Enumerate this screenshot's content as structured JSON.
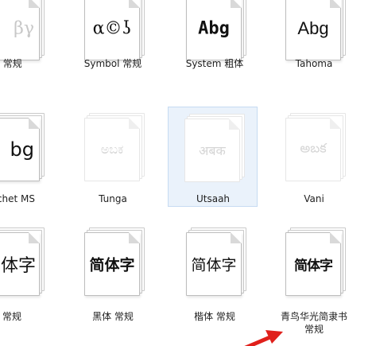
{
  "fonts": {
    "row1": [
      {
        "label": "n 常规",
        "preview": "βγ"
      },
      {
        "label": "Symbol 常规",
        "preview": "α©ʖ"
      },
      {
        "label": "System 粗体",
        "preview": "Abg"
      },
      {
        "label": "Tahoma",
        "preview": "Abg"
      }
    ],
    "row2": [
      {
        "label": "chet MS",
        "preview": "bg"
      },
      {
        "label": "Tunga",
        "preview": "ಅಬಕ"
      },
      {
        "label": "Utsaah",
        "preview": "अबक"
      },
      {
        "label": "Vani",
        "preview": "అబక"
      }
    ],
    "row3": [
      {
        "label": "常规",
        "preview": "体字"
      },
      {
        "label": "黑体 常规",
        "preview": "简体字"
      },
      {
        "label": "楷体 常规",
        "preview": "简体字"
      },
      {
        "label": "青鸟华光简隶书 常规",
        "preview": "简体字"
      }
    ]
  },
  "colors": {
    "selection_bg": "#eaf2fb",
    "annotation_arrow": "#e0201b"
  }
}
